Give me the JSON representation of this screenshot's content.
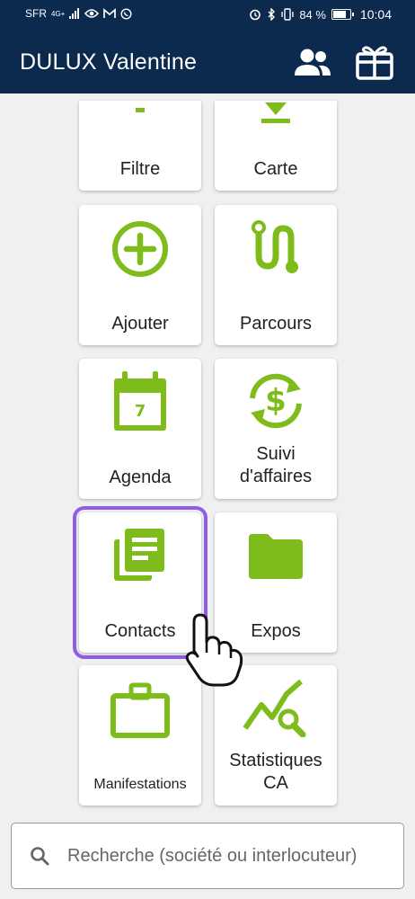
{
  "status_bar": {
    "carrier": "SFR",
    "network": "4G+",
    "battery_text": "84 %",
    "battery_level": 0.84,
    "time": "10:04"
  },
  "app_bar": {
    "title": "DULUX Valentine",
    "icons": [
      "users-icon",
      "gift-icon"
    ]
  },
  "tiles": [
    {
      "label": "Filtre",
      "icon": "filter-icon"
    },
    {
      "label": "Carte",
      "icon": "download-icon"
    },
    {
      "label": "Ajouter",
      "icon": "add-circle-icon"
    },
    {
      "label": "Parcours",
      "icon": "route-icon"
    },
    {
      "label": "Agenda",
      "icon": "calendar-icon",
      "icon_text": "7"
    },
    {
      "label": "Suivi d'affaires",
      "icon": "dollar-sync-icon"
    },
    {
      "label": "Contacts",
      "icon": "contacts-icon",
      "selected": true
    },
    {
      "label": "Expos",
      "icon": "folder-icon"
    },
    {
      "label": "Manifestations",
      "icon": "briefcase-icon"
    },
    {
      "label": "Statistiques CA",
      "icon": "stats-search-icon"
    }
  ],
  "search": {
    "placeholder": "Recherche (société ou interlocuteur)"
  },
  "colors": {
    "header": "#0b2a4e",
    "accent_green": "#7ebc1c",
    "selection": "#8f5ce8",
    "background": "#eef0f2"
  }
}
